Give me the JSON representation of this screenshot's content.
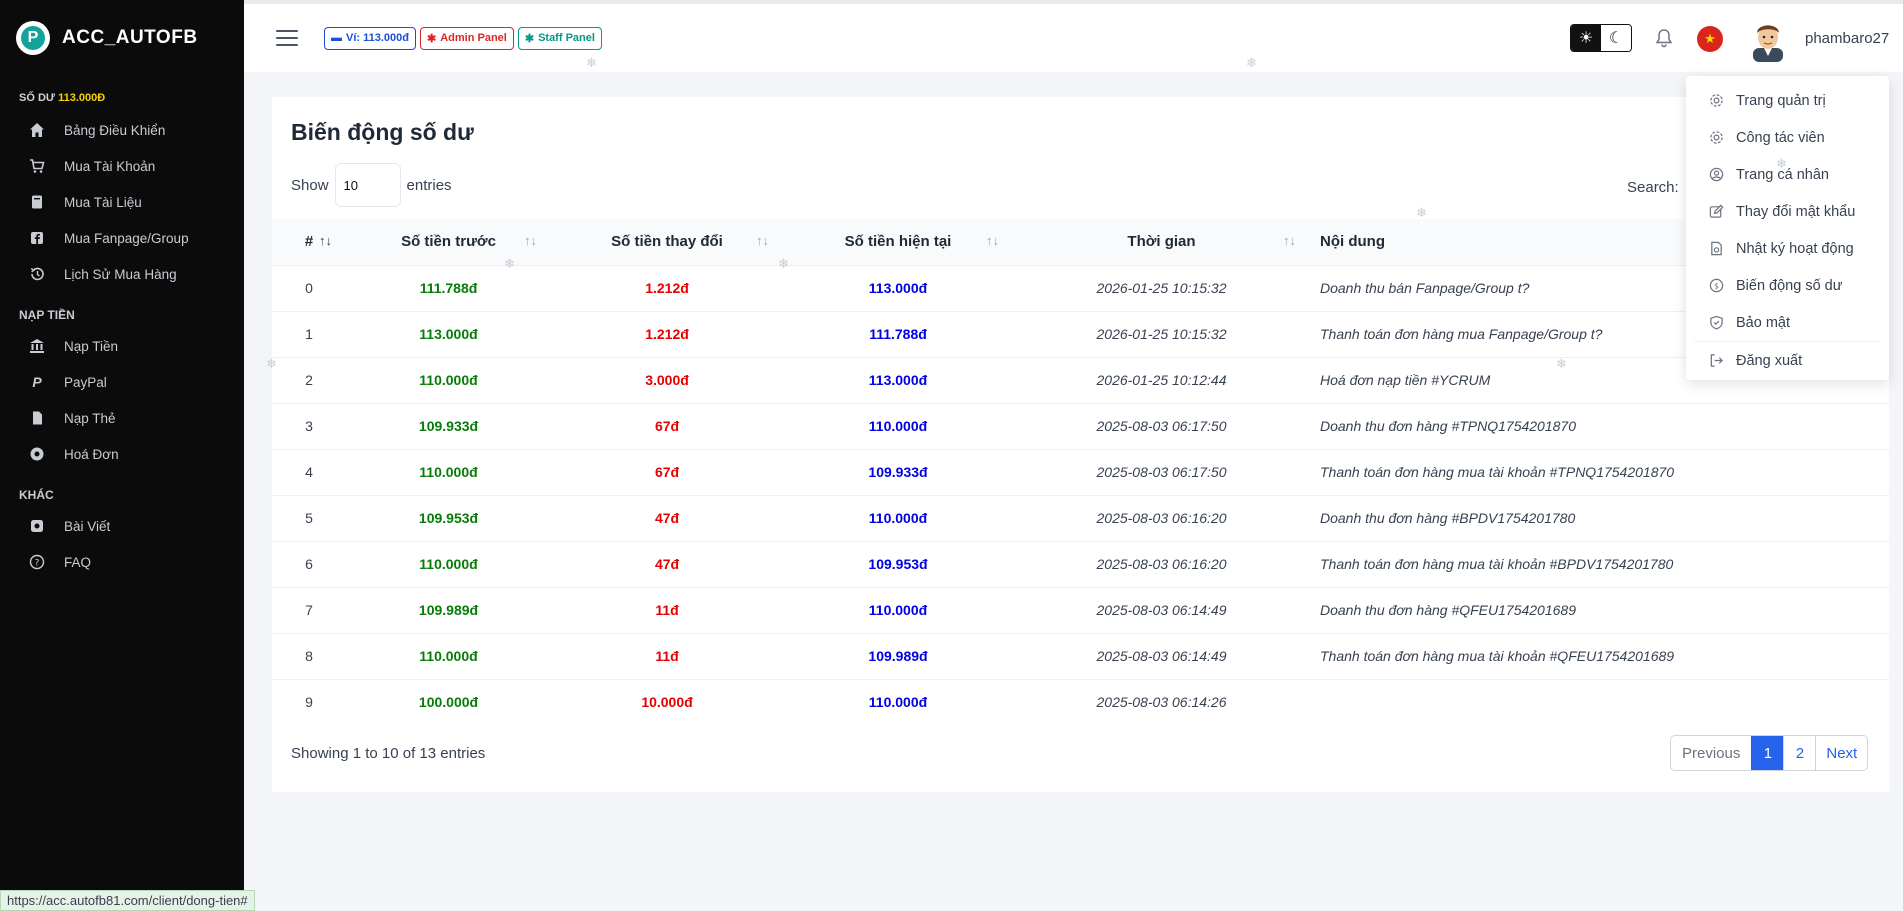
{
  "brand": {
    "name": "ACC_AUTOFB",
    "logo_letter": "P"
  },
  "sidebar": {
    "balance_label": "SỐ DƯ",
    "balance_value": "113.000Đ",
    "main_items": [
      {
        "label": "Bảng Điều Khiển",
        "icon": "home-icon"
      },
      {
        "label": "Mua Tài Khoản",
        "icon": "cart-icon"
      },
      {
        "label": "Mua Tài Liệu",
        "icon": "book-icon"
      },
      {
        "label": "Mua Fanpage/Group",
        "icon": "facebook-icon"
      },
      {
        "label": "Lịch Sử Mua Hàng",
        "icon": "history-icon"
      }
    ],
    "group_topup": "NẠP TIỀN",
    "topup_items": [
      {
        "label": "Nạp Tiền",
        "icon": "bank-icon"
      },
      {
        "label": "PayPal",
        "icon": "paypal-icon"
      },
      {
        "label": "Nạp Thẻ",
        "icon": "card-icon"
      },
      {
        "label": "Hoá Đơn",
        "icon": "invoice-icon"
      }
    ],
    "group_other": "KHÁC",
    "other_items": [
      {
        "label": "Bài Viết",
        "icon": "article-icon"
      },
      {
        "label": "FAQ",
        "icon": "question-icon"
      }
    ]
  },
  "topbar": {
    "wallet_badge": "Ví: 113.000đ",
    "admin_badge": "Admin Panel",
    "staff_badge": "Staff Panel",
    "username": "phambaro27"
  },
  "card": {
    "title": "Biến động số dư",
    "show_label": "Show",
    "entries_label": "entries",
    "page_size": "10",
    "search_label": "Search:",
    "columns": [
      "#",
      "Số tiền trước",
      "Số tiền thay đổi",
      "Số tiền hiện tại",
      "Thời gian",
      "Nội dung"
    ],
    "rows": [
      {
        "idx": "0",
        "before": "111.788đ",
        "change": "1.212đ",
        "after": "113.000đ",
        "time": "2026-01-25 10:15:32",
        "content": "Doanh thu bán Fanpage/Group t?"
      },
      {
        "idx": "1",
        "before": "113.000đ",
        "change": "1.212đ",
        "after": "111.788đ",
        "time": "2026-01-25 10:15:32",
        "content": "Thanh toán đơn hàng mua Fanpage/Group t?"
      },
      {
        "idx": "2",
        "before": "110.000đ",
        "change": "3.000đ",
        "after": "113.000đ",
        "time": "2026-01-25 10:12:44",
        "content": "Hoá đơn nạp tiền #YCRUM"
      },
      {
        "idx": "3",
        "before": "109.933đ",
        "change": "67đ",
        "after": "110.000đ",
        "time": "2025-08-03 06:17:50",
        "content": "Doanh thu đơn hàng #TPNQ1754201870"
      },
      {
        "idx": "4",
        "before": "110.000đ",
        "change": "67đ",
        "after": "109.933đ",
        "time": "2025-08-03 06:17:50",
        "content": "Thanh toán đơn hàng mua tài khoản #TPNQ1754201870"
      },
      {
        "idx": "5",
        "before": "109.953đ",
        "change": "47đ",
        "after": "110.000đ",
        "time": "2025-08-03 06:16:20",
        "content": "Doanh thu đơn hàng #BPDV1754201780"
      },
      {
        "idx": "6",
        "before": "110.000đ",
        "change": "47đ",
        "after": "109.953đ",
        "time": "2025-08-03 06:16:20",
        "content": "Thanh toán đơn hàng mua tài khoản #BPDV1754201780"
      },
      {
        "idx": "7",
        "before": "109.989đ",
        "change": "11đ",
        "after": "110.000đ",
        "time": "2025-08-03 06:14:49",
        "content": "Doanh thu đơn hàng #QFEU1754201689"
      },
      {
        "idx": "8",
        "before": "110.000đ",
        "change": "11đ",
        "after": "109.989đ",
        "time": "2025-08-03 06:14:49",
        "content": "Thanh toán đơn hàng mua tài khoản #QFEU1754201689"
      },
      {
        "idx": "9",
        "before": "100.000đ",
        "change": "10.000đ",
        "after": "110.000đ",
        "time": "2025-08-03 06:14:26",
        "content": ""
      }
    ],
    "footer": "Showing 1 to 10 of 13 entries",
    "pager": {
      "prev": "Previous",
      "pages": [
        "1",
        "2"
      ],
      "next": "Next"
    }
  },
  "dropdown": {
    "items": [
      {
        "label": "Trang quản trị",
        "icon": "gear-icon"
      },
      {
        "label": "Công tác viên",
        "icon": "gear-icon"
      },
      {
        "label": "Trang cá nhân",
        "icon": "user-circle-icon"
      },
      {
        "label": "Thay đổi mật khẩu",
        "icon": "edit-icon"
      },
      {
        "label": "Nhật ký hoạt động",
        "icon": "log-icon"
      },
      {
        "label": "Biến động số dư",
        "icon": "coin-icon"
      },
      {
        "label": "Bảo mật",
        "icon": "shield-icon"
      },
      {
        "label": "Đăng xuất",
        "icon": "logout-icon"
      }
    ]
  },
  "statusbar": {
    "url": "https://acc.autofb81.com/client/dong-tien#"
  },
  "colors": {
    "positive": "#067d06",
    "negative": "#e60000",
    "current": "#0000e6",
    "accent": "#2563eb"
  }
}
